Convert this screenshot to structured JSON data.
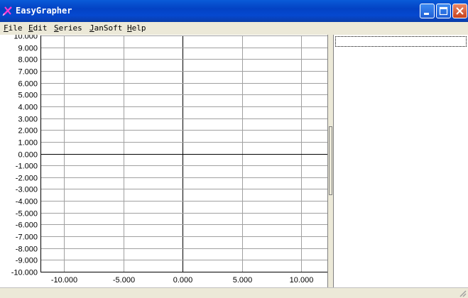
{
  "window": {
    "title": "EasyGrapher",
    "icon": "pen-icon"
  },
  "menu": [
    {
      "id": "file",
      "label": "File"
    },
    {
      "id": "edit",
      "label": "Edit"
    },
    {
      "id": "series",
      "label": "Series"
    },
    {
      "id": "jansoft",
      "label": "JanSoft"
    },
    {
      "id": "help",
      "label": "Help"
    }
  ],
  "controls": {
    "minimize": "minimize-icon",
    "maximize": "maximize-icon",
    "close": "close-icon"
  },
  "chart_data": {
    "type": "line",
    "title": "",
    "xlabel": "",
    "ylabel": "",
    "xlim": [
      -12,
      12.2
    ],
    "ylim": [
      -10,
      10
    ],
    "x_ticks": [
      -10,
      -5,
      0,
      5,
      10
    ],
    "x_tick_labels": [
      "-10.000",
      "-5.000",
      "0.000",
      "5.000",
      "10.000"
    ],
    "y_ticks": [
      10,
      9,
      8,
      7,
      6,
      5,
      4,
      3,
      2,
      1,
      0,
      -1,
      -2,
      -3,
      -4,
      -5,
      -6,
      -7,
      -8,
      -9,
      -10
    ],
    "y_tick_labels": [
      "10.000",
      "9.000",
      "8.000",
      "7.000",
      "6.000",
      "5.000",
      "4.000",
      "3.000",
      "2.000",
      "1.000",
      "0.000",
      "-1.000",
      "-2.000",
      "-3.000",
      "-4.000",
      "-5.000",
      "-6.000",
      "-7.000",
      "-8.000",
      "-9.000",
      "-10.000"
    ],
    "grid": true,
    "series": []
  },
  "colors": {
    "grid": "#a0a0a0",
    "axis": "#000000",
    "background": "#ffffff"
  }
}
